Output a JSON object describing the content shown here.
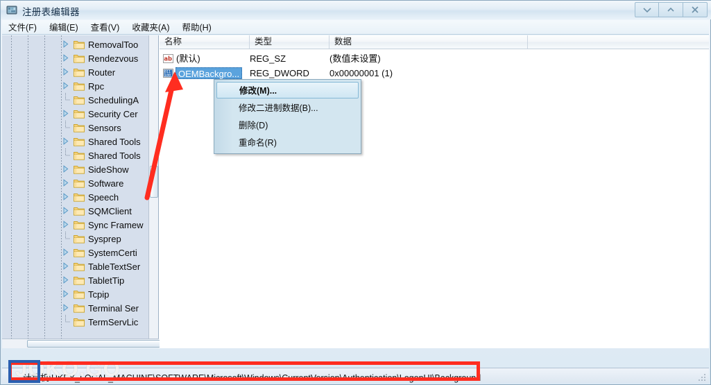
{
  "window": {
    "title": "注册表编辑器",
    "icon": "registry-editor-icon",
    "controls": [
      {
        "name": "minimize-button",
        "glyph": "minimize-chevron-icon"
      },
      {
        "name": "maximize-button",
        "glyph": "maximize-chevron-icon"
      },
      {
        "name": "close-button",
        "glyph": "close-x-icon"
      }
    ]
  },
  "menubar": {
    "items": [
      {
        "label": "文件(F)",
        "name": "menu-file"
      },
      {
        "label": "编辑(E)",
        "name": "menu-edit"
      },
      {
        "label": "查看(V)",
        "name": "menu-view"
      },
      {
        "label": "收藏夹(A)",
        "name": "menu-favorites"
      },
      {
        "label": "帮助(H)",
        "name": "menu-help"
      }
    ]
  },
  "tree": {
    "items": [
      {
        "label": "RemovalToo",
        "expandable": true
      },
      {
        "label": "Rendezvous",
        "expandable": true
      },
      {
        "label": "Router",
        "expandable": true
      },
      {
        "label": "Rpc",
        "expandable": true
      },
      {
        "label": "SchedulingA",
        "expandable": false
      },
      {
        "label": "Security Cer",
        "expandable": true
      },
      {
        "label": "Sensors",
        "expandable": false
      },
      {
        "label": "Shared Tools",
        "expandable": true
      },
      {
        "label": "Shared Tools",
        "expandable": false
      },
      {
        "label": "SideShow",
        "expandable": true
      },
      {
        "label": "Software",
        "expandable": true
      },
      {
        "label": "Speech",
        "expandable": true
      },
      {
        "label": "SQMClient",
        "expandable": true
      },
      {
        "label": "Sync Framew",
        "expandable": true
      },
      {
        "label": "Sysprep",
        "expandable": false
      },
      {
        "label": "SystemCerti",
        "expandable": true
      },
      {
        "label": "TableTextSer",
        "expandable": true
      },
      {
        "label": "TabletTip",
        "expandable": true
      },
      {
        "label": "Tcpip",
        "expandable": true
      },
      {
        "label": "Terminal Ser",
        "expandable": true
      },
      {
        "label": "TermServLic",
        "expandable": false
      }
    ]
  },
  "list": {
    "columns": [
      {
        "label": "名称",
        "name": "column-name"
      },
      {
        "label": "类型",
        "name": "column-type"
      },
      {
        "label": "数据",
        "name": "column-data"
      }
    ],
    "rows": [
      {
        "name": "(默认)",
        "type": "REG_SZ",
        "data": "(数值未设置)",
        "icon": "string-value-icon",
        "selected": false
      },
      {
        "name": "OEMBackgro...",
        "type": "REG_DWORD",
        "data": "0x00000001 (1)",
        "icon": "binary-value-icon",
        "selected": true
      }
    ]
  },
  "context_menu": {
    "items": [
      {
        "label": "修改(M)...",
        "name": "context-modify",
        "highlighted": true
      },
      {
        "label": "修改二进制数据(B)...",
        "name": "context-modify-binary",
        "highlighted": false
      },
      {
        "label": "删除(D)",
        "name": "context-delete",
        "highlighted": false
      },
      {
        "label": "重命名(R)",
        "name": "context-rename",
        "highlighted": false
      }
    ]
  },
  "statusbar": {
    "path": "计算机\\HKEY_LOCAL_MACHINE\\SOFTWARE\\Microsoft\\Windows\\CurrentVersion\\Authentication\\LogonUI\\Background"
  },
  "annotations": {
    "watermark": "JOKO.GO",
    "red_box_color": "#ff2d20",
    "blue_box_color": "#2a5fb0",
    "arrow_color": "#ff2d20"
  }
}
